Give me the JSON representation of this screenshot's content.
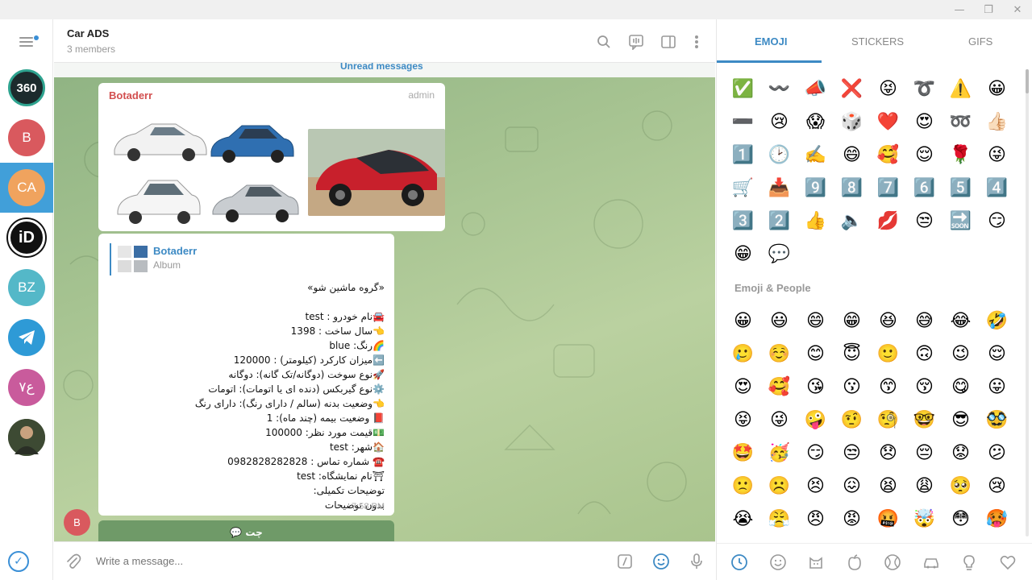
{
  "window": {
    "minimize": "—",
    "maximize": "❐",
    "close": "✕"
  },
  "rail": {
    "chats": [
      {
        "initials": "360",
        "color": "#1c2b2d"
      },
      {
        "initials": "B",
        "color": "#d9595e"
      },
      {
        "initials": "CA",
        "color": "#f0a35e"
      },
      {
        "initials": "iD",
        "color": "#111111"
      },
      {
        "initials": "BZ",
        "color": "#54b8c8"
      },
      {
        "initials": "",
        "color": "#2e9ad6"
      },
      {
        "initials": "ع٧",
        "color": "#c95b9c"
      },
      {
        "initials": "",
        "color": "#4a5a3a"
      }
    ]
  },
  "chat": {
    "title": "Car ADS",
    "subtitle": "3 members",
    "unread": "Unread messages",
    "album_sender": "Botaderr",
    "album_badge": "admin",
    "reply_name": "Botaderr",
    "reply_sub": "Album",
    "message_lines": [
      "«گروه ماشین شو»",
      "",
      "🚘نام خودرو : test",
      "👈سال ساخت : 1398",
      "🌈رنگ: blue",
      "⬅️میزان کارکرد (کیلومتر) : 120000",
      "🚀نوع سوخت (دوگانه/تک گانه): دوگانه",
      "⚙️نوع گیربکس (دنده ای یا اتومات): اتومات",
      "👈وضعیت بدنه (سالم / دارای رنگ): دارای رنگ",
      "📕 وضعیت بیمه (چند ماه): 1",
      "💵قیمت مورد نظر:  100000",
      "🏠شهر: test",
      "☎️ شماره تماس : 0982828282828",
      "⛩نام نمایشگاه: test",
      "توضیحات تکمیلی:",
      "بدون توضیحات"
    ],
    "message_time": "7:58 PM",
    "small_avatar": "B",
    "bottom_button": "💬 چت",
    "input_placeholder": "Write a message..."
  },
  "panel": {
    "tabs": [
      "EMOJI",
      "STICKERS",
      "GIFS"
    ],
    "recent": [
      "✅",
      "〰️",
      "📣",
      "❌",
      "😝",
      "➰",
      "⚠️",
      "😀",
      "➖",
      "😢",
      "😱",
      "🎲",
      "❤️",
      "😍",
      "➿",
      "👍🏻",
      "1️⃣",
      "🕑",
      "✍️",
      "😄",
      "🥰",
      "😌",
      "🌹",
      "😜",
      "🛒",
      "📥",
      "9️⃣",
      "8️⃣",
      "7️⃣",
      "6️⃣",
      "5️⃣",
      "4️⃣",
      "3️⃣",
      "2️⃣",
      "👍",
      "🔈",
      "💋",
      "😒",
      "🔜",
      "😏",
      "😁",
      "💬"
    ],
    "section_title": "Emoji & People",
    "people": [
      "😀",
      "😃",
      "😄",
      "😁",
      "😆",
      "😅",
      "😂",
      "🤣",
      "🥲",
      "☺️",
      "😊",
      "😇",
      "🙂",
      "🙃",
      "😉",
      "😌",
      "😍",
      "🥰",
      "😘",
      "😗",
      "😙",
      "😚",
      "😋",
      "😛",
      "😝",
      "😜",
      "🤪",
      "🤨",
      "🧐",
      "🤓",
      "😎",
      "🥸",
      "🤩",
      "🥳",
      "😏",
      "😒",
      "😞",
      "😔",
      "😟",
      "😕",
      "🙁",
      "☹️",
      "😣",
      "😖",
      "😫",
      "😩",
      "🥺",
      "😢",
      "😭",
      "😤",
      "😠",
      "😡",
      "🤬",
      "🤯",
      "😳",
      "🥵"
    ],
    "categories": [
      "clock-icon",
      "smile-icon",
      "cat-icon",
      "apple-icon",
      "ball-icon",
      "car-icon",
      "bulb-icon",
      "heart-icon"
    ]
  }
}
